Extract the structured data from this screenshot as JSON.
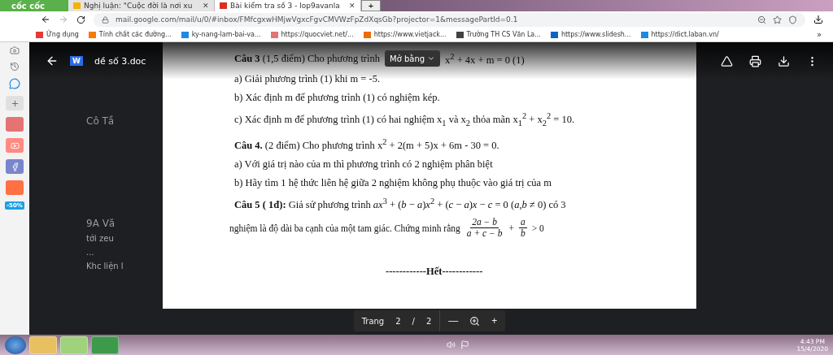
{
  "browser": {
    "logo": "cốc cốc",
    "tabs": [
      {
        "title": "Nghị luận: \"Cuộc đời là nơi xu",
        "selected": false,
        "close": "✕"
      },
      {
        "title": "Bài kiểm tra số 3 - lop9avanla",
        "selected": true,
        "close": "✕"
      }
    ],
    "new_tab": "+",
    "address": "mail.google.com/mail/u/0/#inbox/FMfcgxwHMjwVgxcFgvCMVWzFpZdXqsGb?projector=1&messagePartId=0.1",
    "bookmarks": [
      {
        "label": "Ứng dụng",
        "color": "#e53935"
      },
      {
        "label": "Tính chất các đường...",
        "color": "#f57c00"
      },
      {
        "label": "ky-nang-lam-bai-va...",
        "color": "#1e88e5"
      },
      {
        "label": "https://quocviet.net/...",
        "color": "#e57373"
      },
      {
        "label": "https://www.vietjack...",
        "color": "#ef6c00"
      },
      {
        "label": "Trường TH CS Văn La...",
        "color": "#424242"
      },
      {
        "label": "https://www.slidesh...",
        "color": "#0a66c2"
      },
      {
        "label": "https://dict.laban.vn/",
        "color": "#1e88e5"
      }
    ],
    "bookmarks_more": "»",
    "side_badge": "-50%"
  },
  "background": {
    "heading": "Cô Tầ",
    "sender": "9A Vă",
    "snippet": "tới zeu",
    "dots": "...",
    "left_text": "Khc liện l"
  },
  "viewer": {
    "file_name": "dề số 3.doc",
    "file_badge": "W",
    "open_with": "Mở bằng",
    "lines": [
      {
        "kind": "covered",
        "text": "**Câu 3** (1,5 điểm) Cho phương trình",
        "tail": "x$^{2}$ + 4x + m = 0 (1)"
      },
      {
        "kind": "text",
        "text": "a) Giải phương trình (1) khi m = -5."
      },
      {
        "kind": "text",
        "text": "b) Xác định m để phương trình (1) có nghiệm kép."
      },
      {
        "kind": "text",
        "text": "c) Xác định m để phương trình (1) có hai nghiệm x$_{1}$ và x$_{2}$ thỏa mãn x$_{1}$$^{2}$ + x$_{2}$$^{2}$ = 10."
      },
      {
        "kind": "text",
        "text": "**Câu 4.** (2 điểm) Cho phương trình x$^{2}$ + 2(m + 5)x + 6m - 30 = 0."
      },
      {
        "kind": "text",
        "text": "a) Với giá trị nào của m thì phương trình có 2 nghiệm phân biệt"
      },
      {
        "kind": "text",
        "text": "b) Hãy tìm 1 hệ thức liên hệ giữa 2 nghiệm không phụ thuộc vào giá trị của m"
      },
      {
        "kind": "text",
        "text": "**Câu 5 ( 1đ):** Giả sử phương trình *ax*$^{3}$ + (*b* − *a*)*x*$^{2}$ + (*c* − *a*)*x* − *c* = 0  (*a*,*b* ≠ 0) có 3"
      },
      {
        "kind": "fraction_line",
        "text": "nghiệm là độ dài ba cạnh của một tam giác. Chứng minh rằng",
        "fractions": [
          {
            "num": "2a − b",
            "den": "a + c − b"
          },
          {
            "num": "a",
            "den": "b"
          }
        ],
        "plus": "+",
        "tail": "> 0"
      },
      {
        "kind": "end",
        "text": "------------Hết------------"
      }
    ],
    "pager": {
      "label": "Trang",
      "page": "2",
      "sep": "/",
      "total": "2",
      "zoom_out": "—",
      "zoom_in": "+"
    }
  },
  "taskbar": {
    "time": "4:43 PM",
    "date": "15/4/2020"
  }
}
